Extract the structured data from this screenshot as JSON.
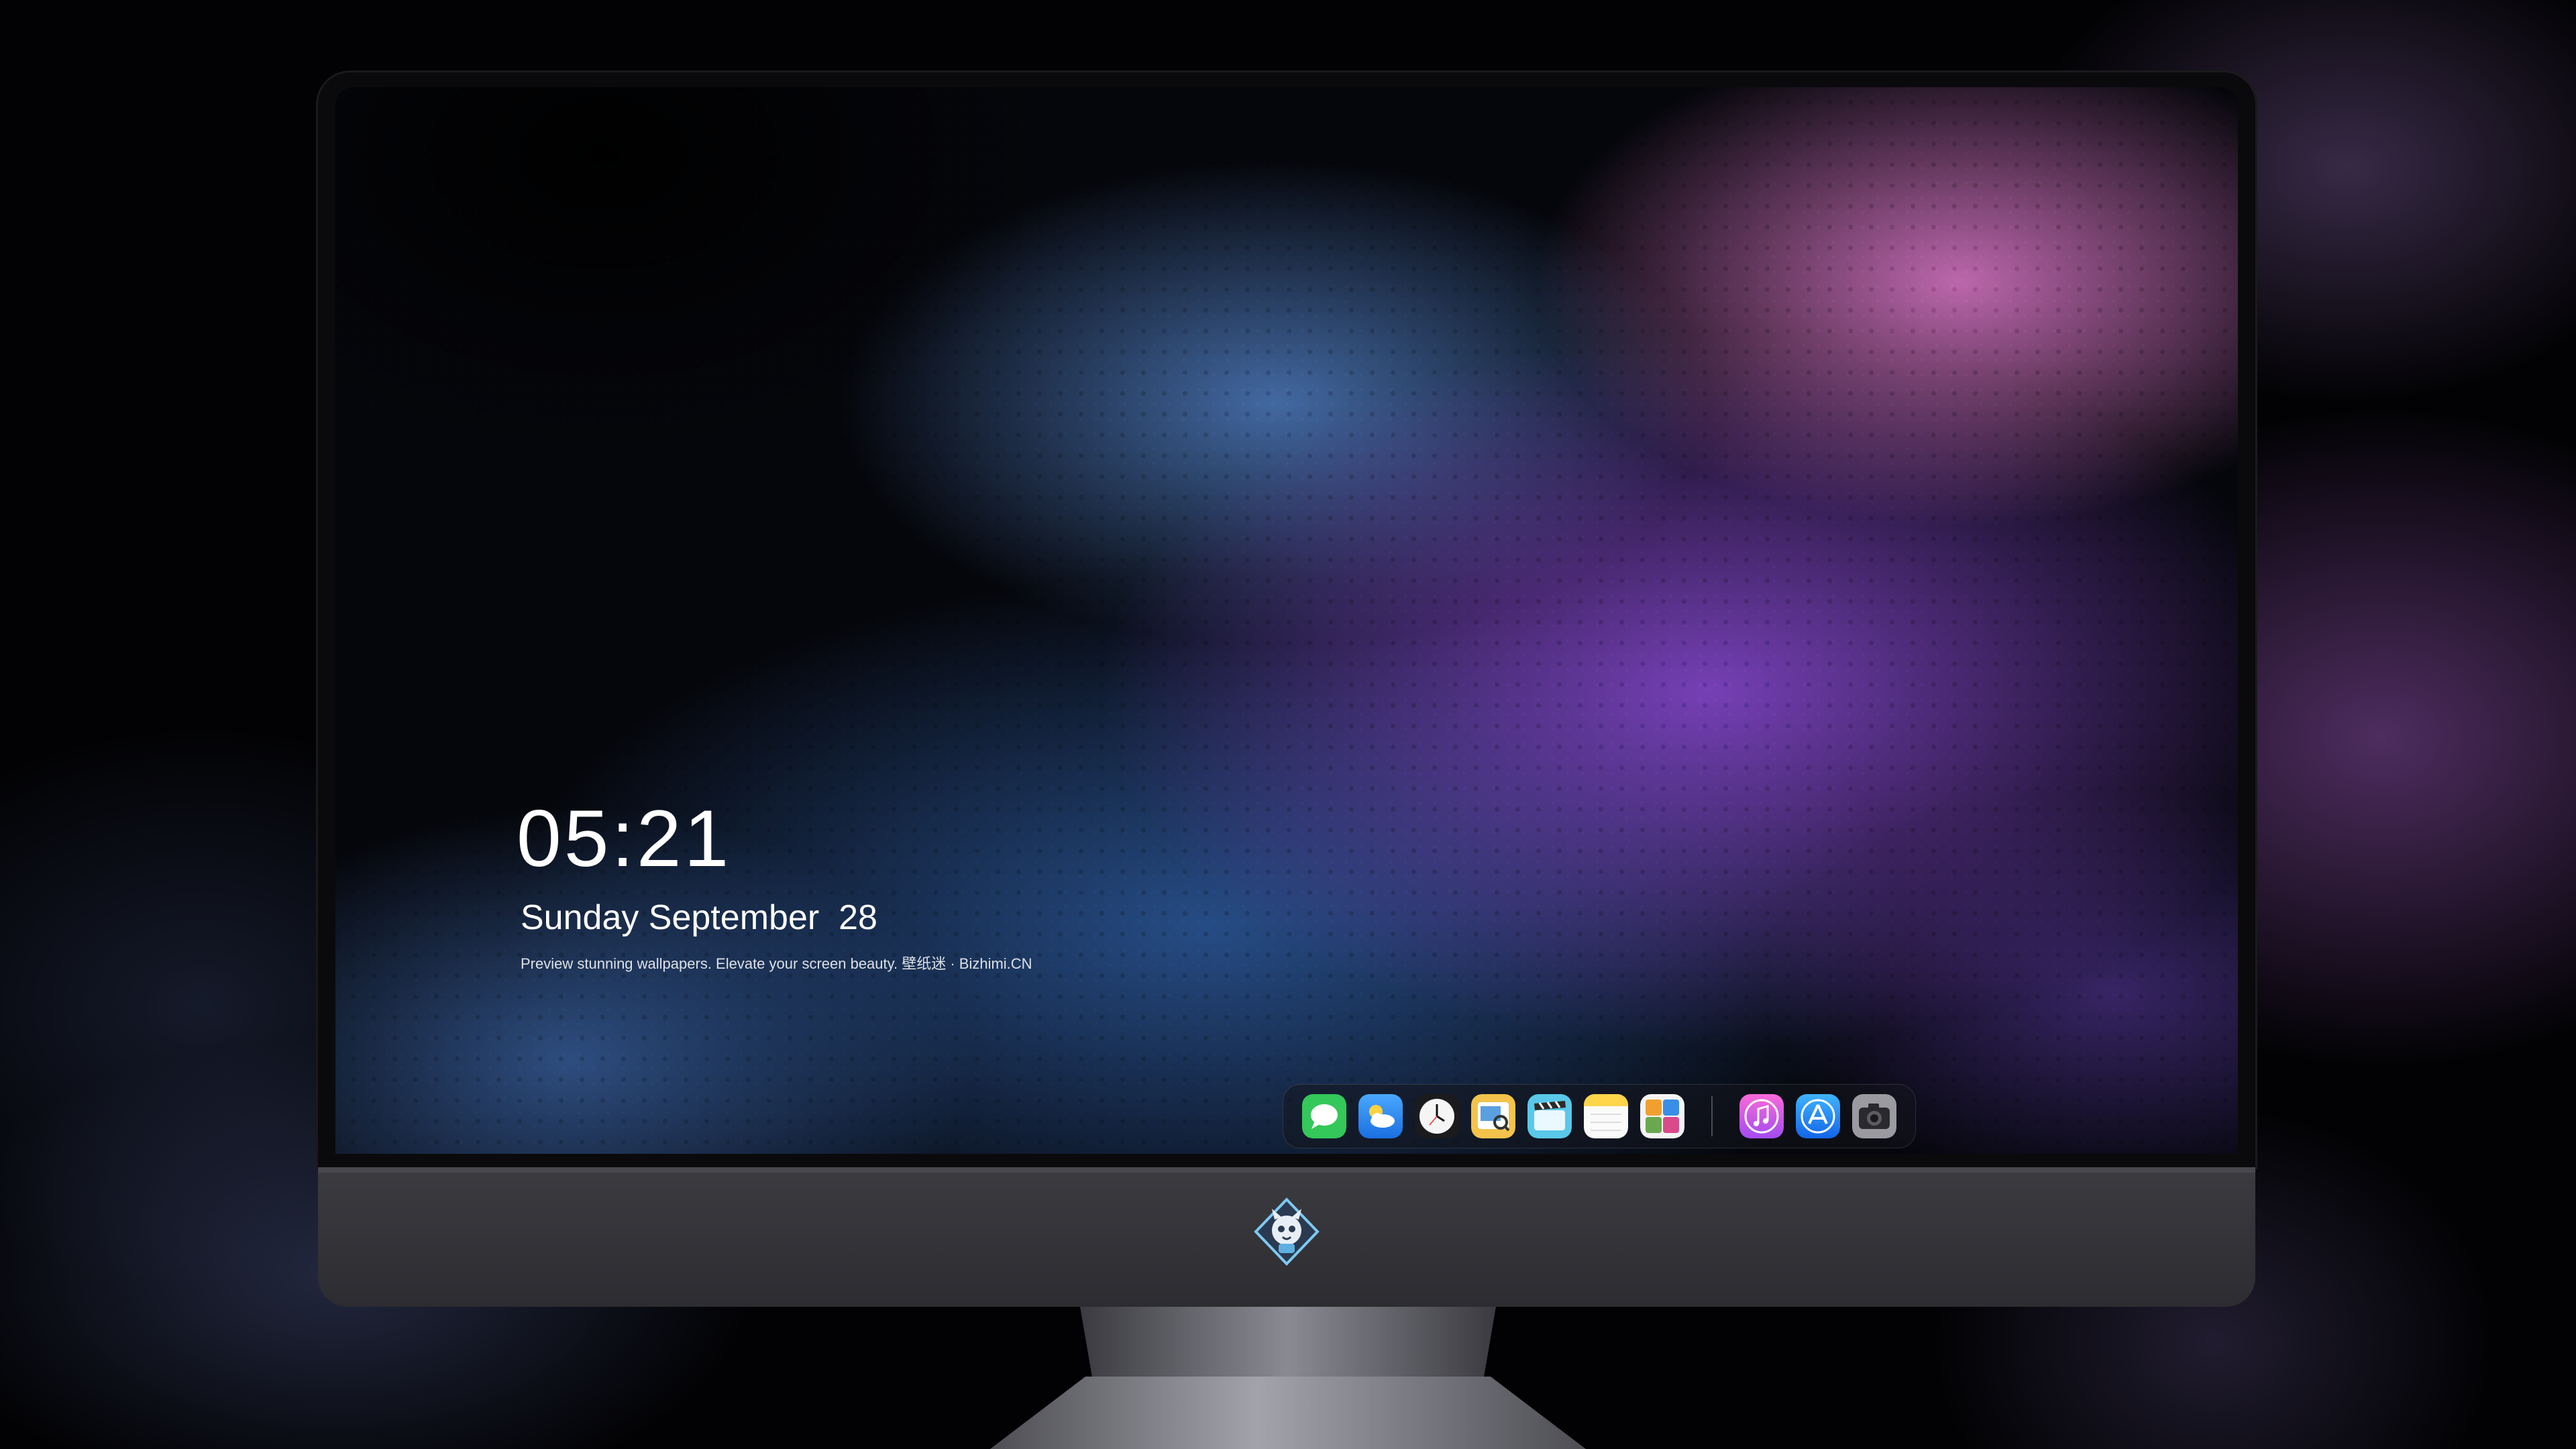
{
  "lock_screen": {
    "time": "05:21",
    "date": "Sunday September  28",
    "caption": "Preview stunning wallpapers. Elevate your screen beauty. 壁纸迷 · Bizhimi.CN"
  },
  "dock": {
    "apps": [
      {
        "name": "messages-icon",
        "color": "#34c759"
      },
      {
        "name": "weather-icon",
        "color": "#2f8cf5"
      },
      {
        "name": "clock-icon",
        "color": "#f2f2f2"
      },
      {
        "name": "preview-icon",
        "color": "#f3c34b"
      },
      {
        "name": "clips-icon",
        "color": "#5ac8e8"
      },
      {
        "name": "notes-icon",
        "color": "#ffd54a"
      },
      {
        "name": "photo-booth-icon",
        "color": "#6aa84f"
      },
      {
        "name": "music-icon",
        "color": "#e64fd8"
      },
      {
        "name": "app-store-icon",
        "color": "#1c8cf5"
      },
      {
        "name": "camera-icon",
        "color": "#8e8e93"
      }
    ]
  },
  "colors": {
    "monitor_chin": "#3b3b40",
    "bezel": "#0a0a0c",
    "text": "#ffffff"
  }
}
